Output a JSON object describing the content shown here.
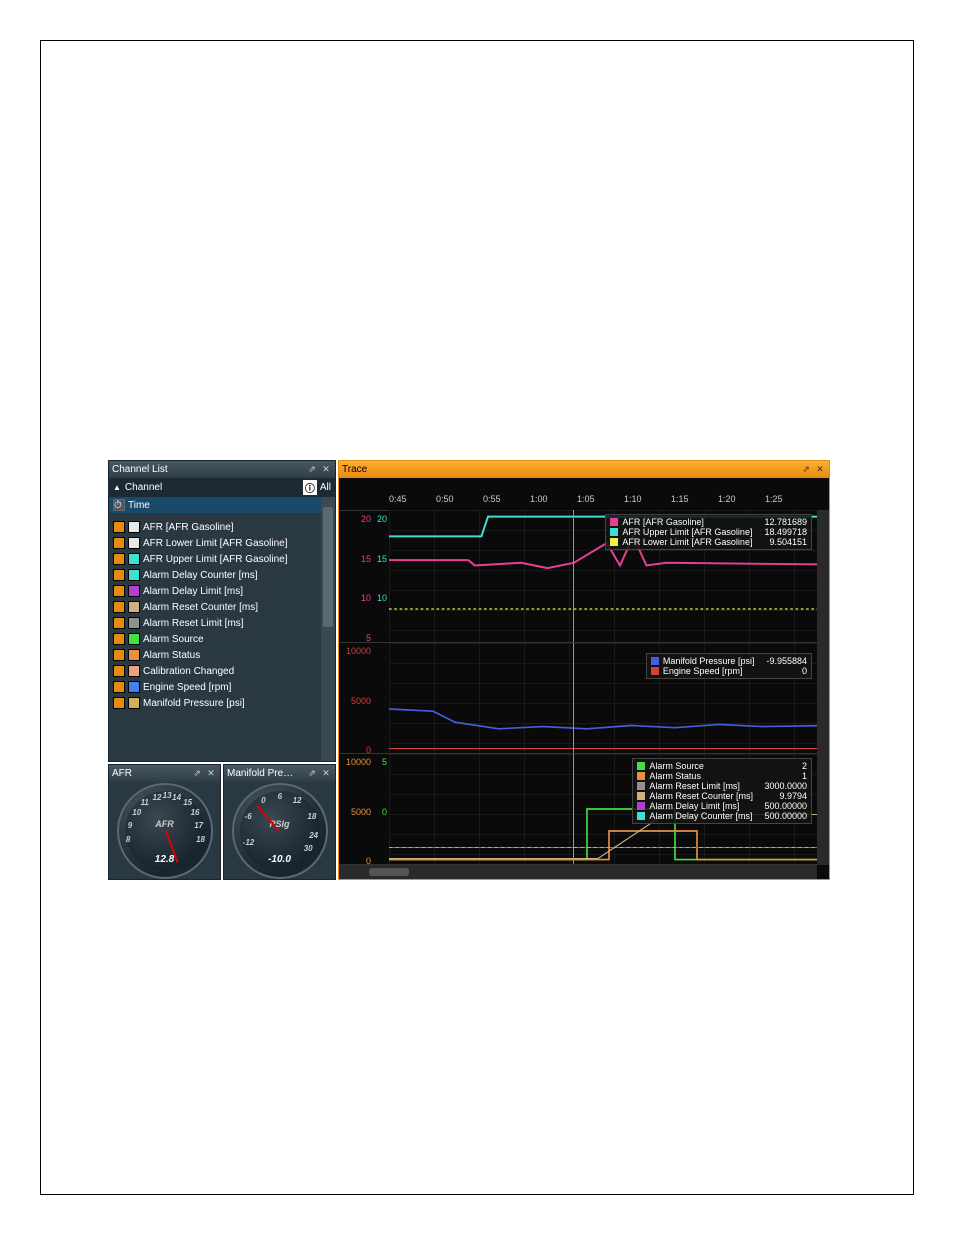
{
  "channelList": {
    "title": "Channel List",
    "header": "Channel",
    "allLabel": "All",
    "timeLabel": "Time",
    "items": [
      {
        "color1": "#e88a10",
        "color2": "#e8e8e8",
        "label": "AFR [AFR Gasoline]"
      },
      {
        "color1": "#e88a10",
        "color2": "#e8e8e8",
        "label": "AFR Lower Limit [AFR Gasoline]"
      },
      {
        "color1": "#e88a10",
        "color2": "#40e0d0",
        "label": "AFR Upper Limit [AFR Gasoline]"
      },
      {
        "color1": "#e88a10",
        "color2": "#40e0d0",
        "label": "Alarm Delay Counter [ms]"
      },
      {
        "color1": "#e88a10",
        "color2": "#b040d0",
        "label": "Alarm Delay Limit [ms]"
      },
      {
        "color1": "#e88a10",
        "color2": "#d0b080",
        "label": "Alarm Reset Counter [ms]"
      },
      {
        "color1": "#e88a10",
        "color2": "#909090",
        "label": "Alarm Reset Limit [ms]"
      },
      {
        "color1": "#e88a10",
        "color2": "#40e040",
        "label": "Alarm Source"
      },
      {
        "color1": "#e88a10",
        "color2": "#e89040",
        "label": "Alarm Status"
      },
      {
        "color1": "#e88a10",
        "color2": "#f0a080",
        "label": "Calibration Changed"
      },
      {
        "color1": "#e88a10",
        "color2": "#4080f0",
        "label": "Engine Speed [rpm]"
      },
      {
        "color1": "#e88a10",
        "color2": "#d0b060",
        "label": "Manifold Pressure [psi]"
      }
    ]
  },
  "gauge1": {
    "title": "AFR",
    "label": "AFR",
    "value": "12.8",
    "ticks": [
      "8",
      "9",
      "10",
      "11",
      "12",
      "13",
      "14",
      "15",
      "16",
      "17",
      "18"
    ]
  },
  "gauge2": {
    "title": "Manifold Pre…",
    "label": "PSIg",
    "value": "-10.0",
    "ticks": [
      "-12",
      "-6",
      "0",
      "6",
      "12",
      "18",
      "24",
      "30"
    ]
  },
  "trace": {
    "title": "Trace",
    "timeLabels": [
      "0:45",
      "0:50",
      "0:55",
      "1:00",
      "1:05",
      "1:10",
      "1:15",
      "1:20",
      "1:25"
    ],
    "plot1": {
      "yticks": [
        {
          "v": "20",
          "c": "#e84090"
        },
        {
          "v": "15",
          "c": "#e84090"
        },
        {
          "v": "10",
          "c": "#e84090"
        },
        {
          "v": "5",
          "c": "#e84090"
        }
      ],
      "yticks2": [
        {
          "v": "20",
          "c": "#40e0d0"
        },
        {
          "v": "15",
          "c": "#40e0d0"
        },
        {
          "v": "10",
          "c": "#40e0d0"
        }
      ],
      "legend": [
        {
          "c": "#e84090",
          "n": "AFR [AFR Gasoline]",
          "v": "12.781689"
        },
        {
          "c": "#40e0d0",
          "n": "AFR Upper Limit [AFR Gasoline]",
          "v": "18.499718"
        },
        {
          "c": "#f0f040",
          "n": "AFR Lower Limit [AFR Gasoline]",
          "v": "9.504151"
        }
      ]
    },
    "plot2": {
      "yticks": [
        {
          "v": "10000",
          "c": "#d04040"
        },
        {
          "v": "5000",
          "c": "#d04040"
        },
        {
          "v": "0",
          "c": "#d04040"
        }
      ],
      "legend": [
        {
          "c": "#4060e0",
          "n": "Manifold Pressure [psi]",
          "v": "-9.955884"
        },
        {
          "c": "#d04040",
          "n": "Engine Speed [rpm]",
          "v": "0"
        }
      ]
    },
    "plot3": {
      "yticks": [
        {
          "v": "10000",
          "c": "#e89040"
        },
        {
          "v": "5000",
          "c": "#e89040"
        },
        {
          "v": "0",
          "c": "#e89040"
        }
      ],
      "yticks2": [
        {
          "v": "5",
          "c": "#40e040"
        },
        {
          "v": "0",
          "c": "#40e040"
        }
      ],
      "legend": [
        {
          "c": "#40e040",
          "n": "Alarm Source",
          "v": "2"
        },
        {
          "c": "#e89040",
          "n": "Alarm Status",
          "v": "1"
        },
        {
          "c": "#909090",
          "n": "Alarm Reset Limit [ms]",
          "v": "3000.0000"
        },
        {
          "c": "#d0b080",
          "n": "Alarm Reset Counter [ms]",
          "v": "9.9794"
        },
        {
          "c": "#b040d0",
          "n": "Alarm Delay Limit [ms]",
          "v": "500.00000"
        },
        {
          "c": "#40e0d0",
          "n": "Alarm Delay Counter [ms]",
          "v": "500.00000"
        }
      ]
    }
  },
  "chart_data": {
    "type": "line",
    "time_axis": [
      "0:45",
      "0:50",
      "0:55",
      "1:00",
      "1:05",
      "1:10",
      "1:15",
      "1:20",
      "1:25"
    ],
    "panels": [
      {
        "ylim": [
          5,
          20
        ],
        "series": [
          {
            "name": "AFR [AFR Gasoline]",
            "cursor_value": 12.781689,
            "color": "#e84090"
          },
          {
            "name": "AFR Upper Limit [AFR Gasoline]",
            "cursor_value": 18.499718,
            "color": "#40e0d0"
          },
          {
            "name": "AFR Lower Limit [AFR Gasoline]",
            "cursor_value": 9.504151,
            "color": "#f0f040"
          }
        ]
      },
      {
        "ylim": [
          0,
          10000
        ],
        "series": [
          {
            "name": "Manifold Pressure [psi]",
            "cursor_value": -9.955884,
            "color": "#4060e0"
          },
          {
            "name": "Engine Speed [rpm]",
            "cursor_value": 0,
            "color": "#d04040"
          }
        ]
      },
      {
        "ylim": [
          0,
          10000
        ],
        "series": [
          {
            "name": "Alarm Source",
            "cursor_value": 2,
            "color": "#40e040"
          },
          {
            "name": "Alarm Status",
            "cursor_value": 1,
            "color": "#e89040"
          },
          {
            "name": "Alarm Reset Limit [ms]",
            "cursor_value": 3000.0,
            "color": "#909090"
          },
          {
            "name": "Alarm Reset Counter [ms]",
            "cursor_value": 9.9794,
            "color": "#d0b080"
          },
          {
            "name": "Alarm Delay Limit [ms]",
            "cursor_value": 500.0,
            "color": "#b040d0"
          },
          {
            "name": "Alarm Delay Counter [ms]",
            "cursor_value": 500.0,
            "color": "#40e0d0"
          }
        ]
      }
    ]
  }
}
